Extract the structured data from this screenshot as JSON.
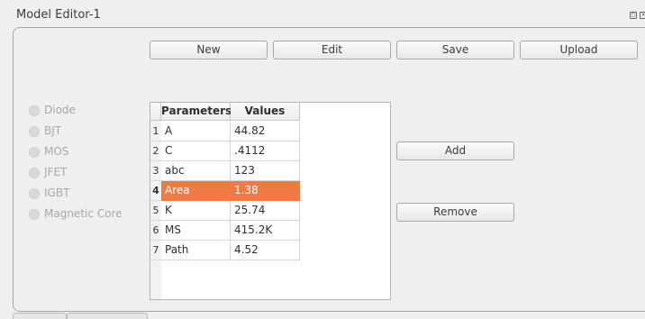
{
  "window": {
    "title": "Model Editor-1"
  },
  "toolbar": {
    "new_label": "New",
    "edit_label": "Edit",
    "save_label": "Save",
    "upload_label": "Upload"
  },
  "device_types": [
    "Diode",
    "BJT",
    "MOS",
    "JFET",
    "IGBT",
    "Magnetic Core"
  ],
  "table": {
    "headers": [
      "Parameters",
      "Values"
    ],
    "rows": [
      {
        "num": "1",
        "param": "A",
        "value": "44.82"
      },
      {
        "num": "2",
        "param": "C",
        "value": ".4112"
      },
      {
        "num": "3",
        "param": "abc",
        "value": "123"
      },
      {
        "num": "4",
        "param": "Area",
        "value": "1.38"
      },
      {
        "num": "5",
        "param": "K",
        "value": "25.74"
      },
      {
        "num": "6",
        "param": "MS",
        "value": "415.2K"
      },
      {
        "num": "7",
        "param": "Path",
        "value": "4.52"
      }
    ],
    "selected_row": 4
  },
  "actions": {
    "add_label": "Add",
    "remove_label": "Remove"
  },
  "colors": {
    "selection": "#f07a44",
    "background": "#efefef"
  }
}
